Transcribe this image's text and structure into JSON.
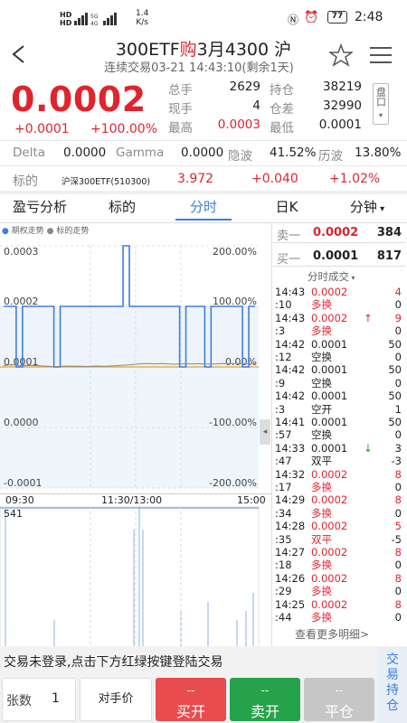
{
  "status_bar": {
    "left_icons": "HD 5G 4G signal",
    "speed_value": "1.4",
    "speed_unit": "K/s",
    "battery": "77",
    "time": "2:48"
  },
  "header": {
    "title_code": "300ETF",
    "title_dir": "购",
    "title_rest": "3月4300 沪",
    "subtitle": "连续交易03-21   14:43:10(剩余1天)"
  },
  "quote": {
    "price": "0.0002",
    "change": "+0.0001",
    "change_pct": "+100.00%",
    "total_vol_label": "总手",
    "total_vol": "2629",
    "oi_label": "持仓",
    "oi": "38219",
    "cur_vol_label": "现手",
    "cur_vol": "4",
    "oi_chg_label": "仓差",
    "oi_chg": "32990",
    "high_label": "最高",
    "high": "0.0003",
    "low_label": "最低",
    "low": "0.0001",
    "disk_label": "盘口",
    "delta_label": "Delta",
    "delta": "0.0000",
    "gamma_label": "Gamma",
    "gamma": "0.0000",
    "iv_label": "隐波",
    "iv": "41.52%",
    "hv_label": "历波",
    "hv": "13.80%",
    "und_label": "标的",
    "und_name": "沪深300ETF(510300)",
    "und_price": "3.972",
    "und_chg": "+0.040",
    "und_pct": "+1.02%"
  },
  "tabs": [
    "盈亏分析",
    "标的",
    "分时",
    "日K",
    "分钟"
  ],
  "active_tab": "分时",
  "chart_data": {
    "type": "line",
    "title": "",
    "legend": [
      "期权走势",
      "标的走势"
    ],
    "y_left_ticks": [
      "0.0003",
      "0.0002",
      "0.0001",
      "0.0000",
      "-0.0001"
    ],
    "y_right_ticks": [
      "200.00%",
      "100.00%",
      "0.00%",
      "-100.00%",
      "-200.00%"
    ],
    "x_ticks": [
      "09:30",
      "11:30/13:00",
      "15:00"
    ],
    "volume_label": "541",
    "series": [
      {
        "name": "期权走势",
        "color": "#3d7fe0",
        "values": [
          0.0002,
          0.0002,
          0.0001,
          0.0002,
          0.0002,
          0.0002,
          0.0002,
          0.0002,
          0.0001,
          0.0002,
          0.0002,
          0.0002,
          0.0002,
          0.0002,
          0.0002,
          0.0002,
          0.0002,
          0.0002,
          0.0002,
          0.0003,
          0.0002,
          0.0002,
          0.0002,
          0.0002,
          0.0002,
          0.0002,
          0.0002,
          0.0002,
          0.0001,
          0.0002,
          0.0002,
          0.0002,
          0.0001,
          0.0002,
          0.0002,
          0.0002,
          0.0002,
          0.0002,
          0.0001,
          0.0002,
          0.0002
        ]
      },
      {
        "name": "标的走势",
        "color": "#888888",
        "values": [
          3.951,
          3.962,
          3.958,
          3.948,
          3.955,
          3.951,
          3.946,
          3.942,
          3.936,
          3.94,
          3.945,
          3.942,
          3.944,
          3.938,
          3.942,
          3.945,
          3.942,
          3.946,
          3.95,
          3.958,
          3.962,
          3.971,
          3.978,
          3.982,
          3.975,
          3.981,
          3.976,
          3.971,
          3.974,
          3.977,
          3.975,
          3.979,
          3.975,
          3.972,
          3.976,
          3.981,
          3.978,
          3.983,
          3.977,
          3.976,
          3.978
        ]
      }
    ]
  },
  "book": {
    "ask_label": "卖一",
    "ask": "0.0002",
    "ask_vol": "384",
    "bid_label": "买一",
    "bid": "0.0001",
    "bid_vol": "817"
  },
  "trades_title": "分时成交",
  "trades": [
    {
      "t": "14:43",
      "p": "0.0002",
      "pc": "red",
      "a": "",
      "v": "4",
      "vc": "red"
    },
    {
      "t": ":10",
      "p": "多换",
      "pc": "red",
      "a": "",
      "v": "0",
      "vc": "blk"
    },
    {
      "t": "14:43",
      "p": "0.0002",
      "pc": "red",
      "a": "↑",
      "v": "9",
      "vc": "red"
    },
    {
      "t": ":3",
      "p": "多换",
      "pc": "red",
      "a": "",
      "v": "0",
      "vc": "blk"
    },
    {
      "t": "14:42",
      "p": "0.0001",
      "pc": "blk",
      "a": "",
      "v": "50",
      "vc": "blk"
    },
    {
      "t": ":12",
      "p": "空换",
      "pc": "blk",
      "a": "",
      "v": "0",
      "vc": "blk"
    },
    {
      "t": "14:42",
      "p": "0.0001",
      "pc": "blk",
      "a": "",
      "v": "50",
      "vc": "blk"
    },
    {
      "t": ":9",
      "p": "空换",
      "pc": "blk",
      "a": "",
      "v": "0",
      "vc": "blk"
    },
    {
      "t": "14:42",
      "p": "0.0001",
      "pc": "blk",
      "a": "",
      "v": "50",
      "vc": "blk"
    },
    {
      "t": ":3",
      "p": "空开",
      "pc": "blk",
      "a": "",
      "v": "1",
      "vc": "blk"
    },
    {
      "t": "14:41",
      "p": "0.0001",
      "pc": "blk",
      "a": "",
      "v": "50",
      "vc": "blk"
    },
    {
      "t": ":57",
      "p": "空换",
      "pc": "blk",
      "a": "",
      "v": "0",
      "vc": "blk"
    },
    {
      "t": "14:33",
      "p": "0.0001",
      "pc": "blk",
      "a": "↓",
      "v": "3",
      "vc": "blk"
    },
    {
      "t": ":47",
      "p": "双平",
      "pc": "blk",
      "a": "",
      "v": "-3",
      "vc": "blk"
    },
    {
      "t": "14:32",
      "p": "0.0002",
      "pc": "red",
      "a": "",
      "v": "8",
      "vc": "red"
    },
    {
      "t": ":17",
      "p": "多换",
      "pc": "red",
      "a": "",
      "v": "0",
      "vc": "blk"
    },
    {
      "t": "14:29",
      "p": "0.0002",
      "pc": "red",
      "a": "",
      "v": "8",
      "vc": "red"
    },
    {
      "t": ":34",
      "p": "多换",
      "pc": "red",
      "a": "",
      "v": "0",
      "vc": "blk"
    },
    {
      "t": "14:28",
      "p": "0.0002",
      "pc": "red",
      "a": "",
      "v": "5",
      "vc": "red"
    },
    {
      "t": ":35",
      "p": "双平",
      "pc": "red",
      "a": "",
      "v": "-5",
      "vc": "blk"
    },
    {
      "t": "14:27",
      "p": "0.0002",
      "pc": "red",
      "a": "",
      "v": "8",
      "vc": "red"
    },
    {
      "t": ":18",
      "p": "多换",
      "pc": "red",
      "a": "",
      "v": "0",
      "vc": "blk"
    },
    {
      "t": "14:26",
      "p": "0.0002",
      "pc": "red",
      "a": "",
      "v": "8",
      "vc": "red"
    },
    {
      "t": ":29",
      "p": "多换",
      "pc": "red",
      "a": "",
      "v": "0",
      "vc": "blk"
    },
    {
      "t": "14:25",
      "p": "0.0002",
      "pc": "red",
      "a": "",
      "v": "8",
      "vc": "red"
    },
    {
      "t": ":44",
      "p": "多换",
      "pc": "red",
      "a": "",
      "v": "0",
      "vc": "blk"
    }
  ],
  "more_link": "查看更多明细>",
  "bottom": {
    "login_notice": "交易未登录,点击下方红绿按键登陆交易",
    "side_label": "交易持仓",
    "qty_label": "张数",
    "qty": "1",
    "price_mode": "对手价",
    "placeholder": "--",
    "buy_open": "买开",
    "sell_open": "卖开",
    "close": "平仓"
  },
  "colors": {
    "red": "#e0242d",
    "green": "#1a9a2b",
    "blue": "#3d7fe0"
  }
}
